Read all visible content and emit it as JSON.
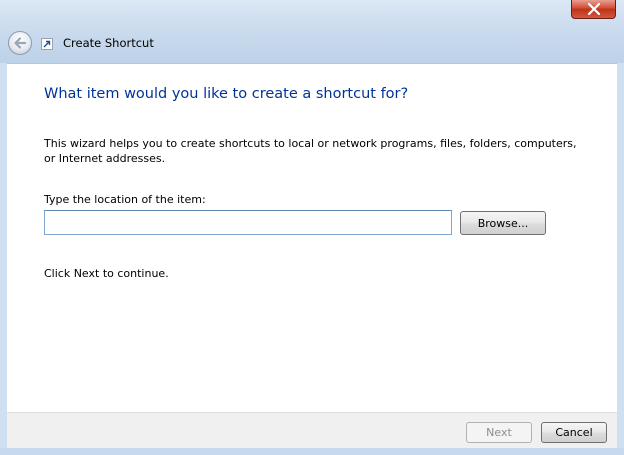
{
  "window": {
    "title": "Create Shortcut",
    "close_label": "close",
    "back_label": "back"
  },
  "wizard": {
    "heading": "What item would you like to create a shortcut for?",
    "description": "This wizard helps you to create shortcuts to local or network programs, files, folders, computers, or Internet addresses.",
    "location_label": "Type the location of the item:",
    "location_value": "",
    "browse_label": "Browse...",
    "continue_text": "Click Next to continue."
  },
  "footer": {
    "next_label": "Next",
    "cancel_label": "Cancel"
  },
  "colors": {
    "heading": "#003399",
    "close_button": "#c0321c",
    "disabled_text": "#8d8d8d"
  },
  "icons": {
    "back": "back-arrow-icon",
    "shortcut": "shortcut-arrow-icon",
    "close": "close-x-icon"
  }
}
